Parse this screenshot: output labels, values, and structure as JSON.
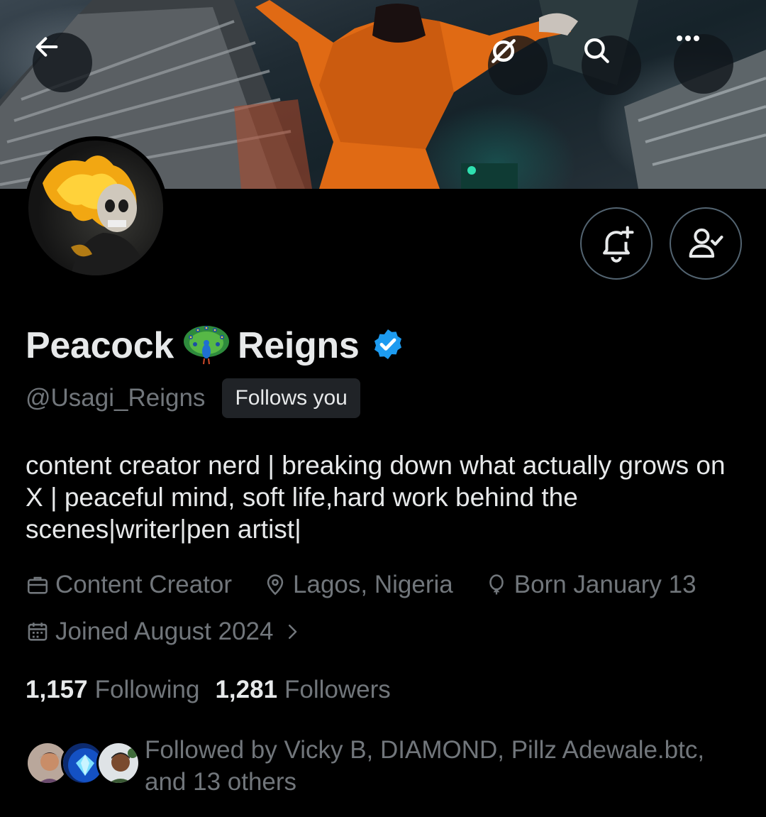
{
  "header": {
    "back_icon": "arrow-left-icon",
    "grok_icon": "grok-icon",
    "search_icon": "search-icon",
    "more_icon": "more-horizontal-icon"
  },
  "profile": {
    "name_first": "Peacock",
    "name_emoji": "peacock-emoji",
    "name_last": "Reigns",
    "verified": true,
    "handle": "@Usagi_Reigns",
    "follows_you": "Follows you",
    "bio": "content creator nerd | breaking down what actually grows on X | peaceful mind, soft life,hard work behind the scenes|writer|pen artist|",
    "category": "Content Creator",
    "location": "Lagos, Nigeria",
    "birthday": "Born January 13",
    "joined": "Joined August 2024",
    "following_count": "1,157",
    "following_label": "Following",
    "followers_count": "1,281",
    "followers_label": "Followers",
    "followed_by": "Followed by Vicky B, DIAMOND, Pillz Adewale.btc, and 13 others"
  },
  "colors": {
    "background": "#000000",
    "text_primary": "#e7e9ea",
    "text_secondary": "#71767b",
    "verified_blue": "#1d9bf0",
    "border": "#536471"
  }
}
